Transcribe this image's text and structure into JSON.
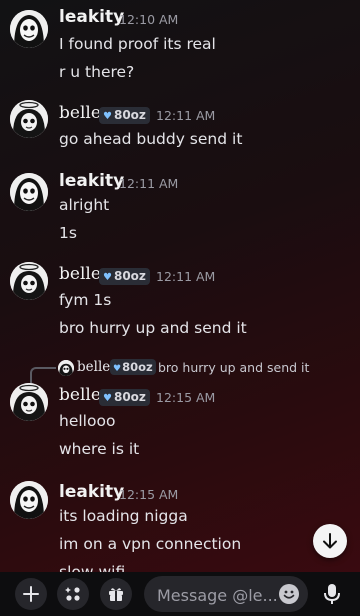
{
  "messages": [
    {
      "author": "leakity",
      "time": "12:10 AM",
      "badge": null,
      "lines": [
        "I found proof its real",
        "r u there?"
      ]
    },
    {
      "author": "belle",
      "time": "12:11 AM",
      "badge": "80oz",
      "lines": [
        "go ahead buddy send it"
      ]
    },
    {
      "author": "leakity",
      "time": "12:11 AM",
      "badge": null,
      "lines": [
        "alright",
        "1s"
      ]
    },
    {
      "author": "belle",
      "time": "12:11 AM",
      "badge": "80oz",
      "lines": [
        "fym 1s",
        "bro hurry up and send it"
      ]
    },
    {
      "author": "belle",
      "time": "12:15 AM",
      "badge": "80oz",
      "lines": [
        "hellooo",
        "where is it"
      ],
      "reply": {
        "author": "belle",
        "badge": "80oz",
        "text": "bro hurry up and send it"
      }
    },
    {
      "author": "leakity",
      "time": "12:15 AM",
      "badge": null,
      "lines": [
        "its loading nigga",
        "im on a vpn connection",
        "slow wifi"
      ]
    }
  ],
  "composer": {
    "placeholder": "Message @le...",
    "buttons": [
      "plus-icon",
      "apps-icon",
      "gift-icon",
      "emoji-icon",
      "microphone-icon"
    ]
  },
  "jump_to_present_icon": "arrow-down-icon",
  "colors": {
    "badge_heart": "#7fc1ff",
    "background_accent": "#3d0a10"
  }
}
